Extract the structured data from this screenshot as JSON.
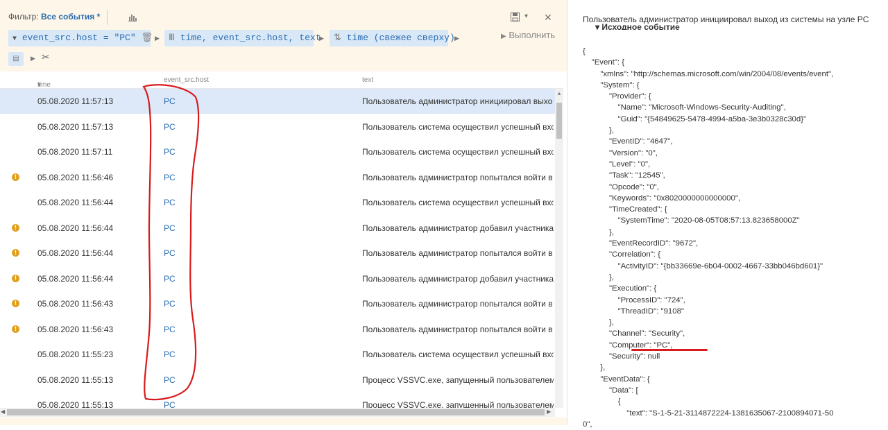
{
  "filter": {
    "label": "Фильтр:",
    "value": "Все события *"
  },
  "toolbar": {
    "chip_host": "event_src.host = \"PC\"",
    "chip_columns": "time, event_src.host, text",
    "chip_sort": "time (свежее сверху)",
    "run_label": "Выполнить"
  },
  "table": {
    "headers": {
      "time": "time",
      "host": "event_src.host",
      "text": "text"
    },
    "rows": [
      {
        "time": "05.08.2020 11:57:13",
        "host": "PC",
        "text": "Пользователь администратор инициировал выхо",
        "warn": false
      },
      {
        "time": "05.08.2020 11:57:13",
        "host": "PC",
        "text": "Пользователь система осуществил успешный вхо",
        "warn": false
      },
      {
        "time": "05.08.2020 11:57:11",
        "host": "PC",
        "text": "Пользователь система осуществил успешный вхо",
        "warn": false
      },
      {
        "time": "05.08.2020 11:56:46",
        "host": "PC",
        "text": "Пользователь администратор попытался войти в",
        "warn": true
      },
      {
        "time": "05.08.2020 11:56:44",
        "host": "PC",
        "text": "Пользователь система осуществил успешный вхо",
        "warn": false
      },
      {
        "time": "05.08.2020 11:56:44",
        "host": "PC",
        "text": "Пользователь администратор добавил участника",
        "warn": true
      },
      {
        "time": "05.08.2020 11:56:44",
        "host": "PC",
        "text": "Пользователь администратор попытался войти в",
        "warn": true
      },
      {
        "time": "05.08.2020 11:56:44",
        "host": "PC",
        "text": "Пользователь администратор добавил участника",
        "warn": true
      },
      {
        "time": "05.08.2020 11:56:43",
        "host": "PC",
        "text": "Пользователь администратор попытался войти в",
        "warn": true
      },
      {
        "time": "05.08.2020 11:56:43",
        "host": "PC",
        "text": "Пользователь администратор попытался войти в",
        "warn": true
      },
      {
        "time": "05.08.2020 11:55:23",
        "host": "PC",
        "text": "Пользователь система осуществил успешный вхо",
        "warn": false
      },
      {
        "time": "05.08.2020 11:55:13",
        "host": "PC",
        "text": "Процесс VSSVC.exe, запущенный пользователем",
        "warn": false
      },
      {
        "time": "05.08.2020 11:55:13",
        "host": "PC",
        "text": "Процесс VSSVC.exe, запущенный пользователем",
        "warn": false
      }
    ]
  },
  "detail": {
    "title": "Пользователь администратор инициировал выход из системы на узле PC",
    "source_label": "Исходное событие",
    "json_lines": [
      "{",
      "    \"Event\": {",
      "        \"xmlns\": \"http://schemas.microsoft.com/win/2004/08/events/event\",",
      "        \"System\": {",
      "            \"Provider\": {",
      "                \"Name\": \"Microsoft-Windows-Security-Auditing\",",
      "                \"Guid\": \"{54849625-5478-4994-a5ba-3e3b0328c30d}\"",
      "            },",
      "            \"EventID\": \"4647\",",
      "            \"Version\": \"0\",",
      "            \"Level\": \"0\",",
      "            \"Task\": \"12545\",",
      "            \"Opcode\": \"0\",",
      "            \"Keywords\": \"0x8020000000000000\",",
      "            \"TimeCreated\": {",
      "                \"SystemTime\": \"2020-08-05T08:57:13.823658000Z\"",
      "            },",
      "            \"EventRecordID\": \"9672\",",
      "            \"Correlation\": {",
      "                \"ActivityID\": \"{bb33669e-6b04-0002-4667-33bb046bd601}\"",
      "            },",
      "            \"Execution\": {",
      "                \"ProcessID\": \"724\",",
      "                \"ThreadID\": \"9108\"",
      "            },",
      "            \"Channel\": \"Security\",",
      "            \"Computer\": \"PC\",",
      "            \"Security\": null",
      "        },",
      "        \"EventData\": {",
      "            \"Data\": [",
      "                {",
      "                    \"text\": \"S-1-5-21-3114872224-1381635067-2100894071-50",
      "0\","
    ]
  },
  "colors": {
    "accent": "#2b6cb0",
    "toolbar_bg": "#fdf6e9",
    "chip_bg": "#d9e8f7",
    "warn": "#e0a020",
    "annotation": "#d81b1b"
  }
}
